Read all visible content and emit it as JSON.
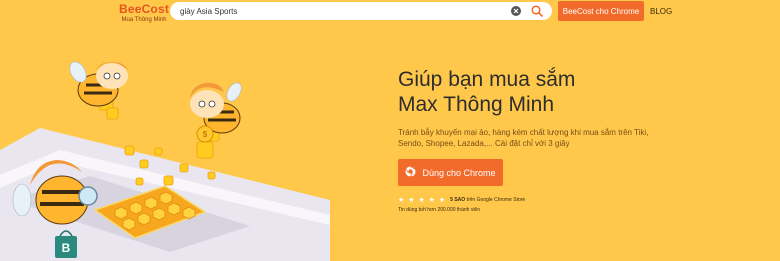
{
  "header": {
    "logo": {
      "name": "BeeCost",
      "tagline": "Mua Thông Minh"
    },
    "search": {
      "value": "giày Asia Sports",
      "placeholder": ""
    },
    "chrome_button": "BeeCost cho Chrome",
    "blog_link": "BLOG"
  },
  "hero": {
    "headline_line1": "Giúp bạn mua sắm",
    "headline_line2": "Max Thông Minh",
    "description": "Tránh bẫy khuyến mại ảo, hàng kém chất lượng khi mua sắm trên Tiki, Sendo, Shopee, Lazada,... Cài đặt chỉ với 3 giây",
    "cta_label": "Dùng cho Chrome",
    "rating": {
      "stars": "★ ★ ★ ★ ★",
      "label_bold": "5 SAO",
      "label_rest": "trên Google Chrome Store"
    },
    "trust_text": "Tin dùng bởi hơn 200.000 thành viên"
  },
  "colors": {
    "background": "#ffc84a",
    "accent": "#f36b2b",
    "logo": "#e8541e"
  },
  "icons": [
    "close-icon",
    "search-icon",
    "chrome-icon",
    "star-icon",
    "shopping-bag-icon"
  ]
}
